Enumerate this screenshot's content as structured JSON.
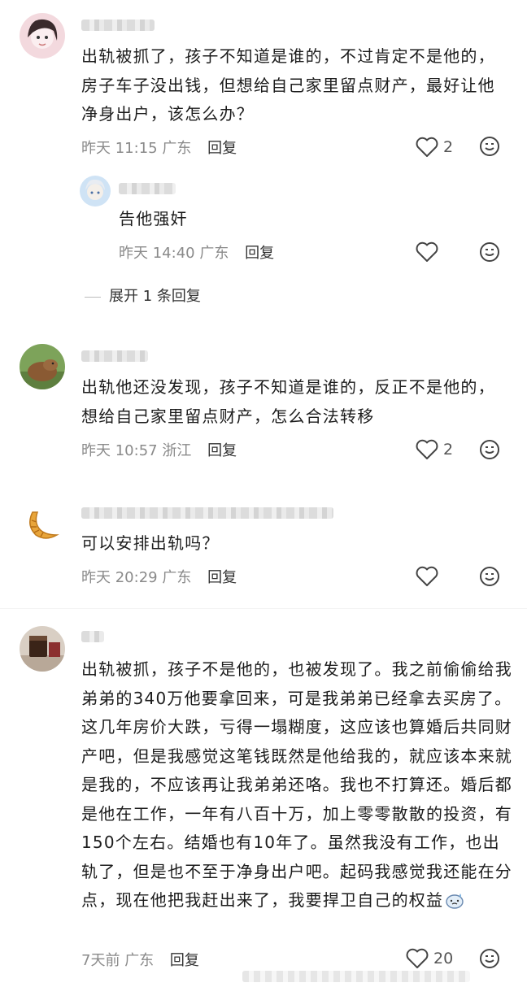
{
  "comments": [
    {
      "text": "出轨被抓了，孩子不知道是谁的，不过肯定不是他的，房子车子没出钱，但想给自己家里留点财产，最好让他净身出户，该怎么办？",
      "time": "昨天 11:15",
      "location": "广东",
      "reply_label": "回复",
      "likes": "2",
      "avatar_icon": "girl-avatar-icon"
    },
    {
      "text": "告他强奸",
      "time": "昨天 14:40",
      "location": "广东",
      "reply_label": "回复",
      "likes": "",
      "avatar_icon": "anime-avatar-icon"
    },
    {
      "text": "出轨他还没发现，孩子不知道是谁的，反正不是他的，想给自己家里留点财产，怎么合法转移",
      "time": "昨天 10:57",
      "location": "浙江",
      "reply_label": "回复",
      "likes": "2",
      "avatar_icon": "capybara-avatar-icon"
    },
    {
      "text": "可以安排出轨吗？",
      "time": "昨天 20:29",
      "location": "广东",
      "reply_label": "回复",
      "likes": "",
      "avatar_icon": "croissant-avatar-icon"
    },
    {
      "text": "出轨被抓，孩子不是他的，也被发现了。我之前偷偷给我弟弟的340万他要拿回来，可是我弟弟已经拿去买房了。这几年房价大跌，亏得一塌糊度，这应该也算婚后共同财产吧，但是我感觉这笔钱既然是他给我的，就应该本来就是我的，不应该再让我弟弟还咯。我也不打算还。婚后都是他在工作，一年有八百十万，加上零零散散的投资，有150个左右。结婚也有10年了。虽然我没有工作，也出轨了，但是也不至于净身出户吧。起码我感觉我还能在分点，现在他把我赶出来了，我要捍卫自己的权益",
      "time": "7天前",
      "location": "广东",
      "reply_label": "回复",
      "likes": "20",
      "avatar_icon": "coffee-avatar-icon"
    }
  ],
  "expand_replies": "展开 1 条回复",
  "emoji_icon": "emoji-icon",
  "heart_icon": "heart-icon"
}
